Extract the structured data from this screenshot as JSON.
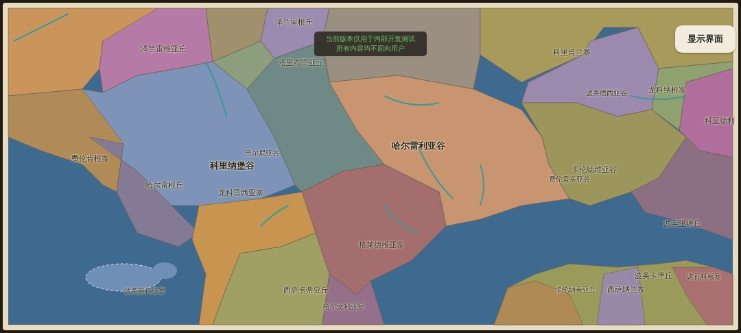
{
  "map": {
    "labels": [
      {
        "text": "泽兰雷维亚丘"
      },
      {
        "text": "泽兰里根丘"
      },
      {
        "text": "塔里布雷亚丘"
      },
      {
        "text": "科里肯兰寨"
      },
      {
        "text": "波美德西亚谷"
      },
      {
        "text": "龙科纳根寨"
      },
      {
        "text": "科里德利"
      },
      {
        "text": "哈尔雷利亚谷"
      },
      {
        "text": "巴尔尼亚谷"
      },
      {
        "text": "科里纳堡谷"
      },
      {
        "text": "费伦肯根寨"
      },
      {
        "text": "哈尔雷根丘"
      },
      {
        "text": "龙科雷西亚寨"
      },
      {
        "text": "卡伦德维亚谷"
      },
      {
        "text": "费伦雷蒂亚谷"
      },
      {
        "text": "波美里堡丘"
      },
      {
        "text": "格莱德维亚寨"
      },
      {
        "text": "波美斯科亚寨"
      },
      {
        "text": "西萨卡蒂亚丘"
      },
      {
        "text": "哈尔文利亚寨"
      },
      {
        "text": "卡伦纳蒂亚丘"
      },
      {
        "text": "西萨纳兰寨"
      },
      {
        "text": "波美卡堡丘"
      },
      {
        "text": "诺瓦科根寨"
      }
    ]
  },
  "notice": {
    "lines": [
      "当前版本仅用于内部开发测试",
      "所有内容均不面向用户"
    ]
  },
  "show_ui_button": {
    "label": "显示界面"
  }
}
